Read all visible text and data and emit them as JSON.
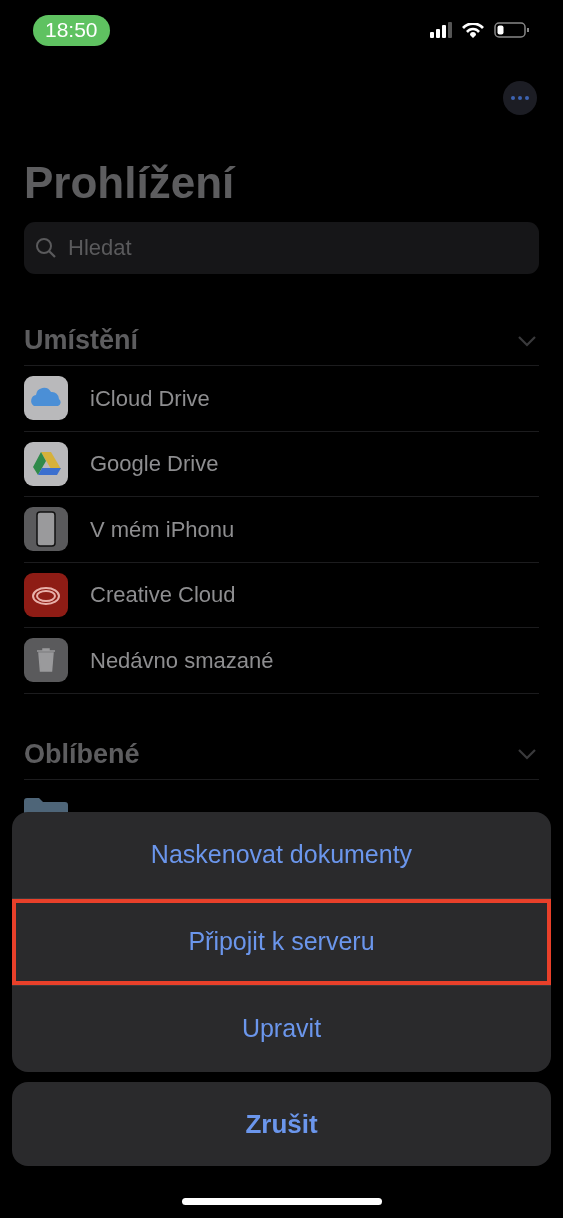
{
  "status_bar": {
    "time": "18:50"
  },
  "title": "Prohlížení",
  "search": {
    "placeholder": "Hledat"
  },
  "sections": [
    {
      "title": "Umístění",
      "expanded": true,
      "items": [
        {
          "kind": "icloud",
          "label": "iCloud Drive"
        },
        {
          "kind": "gdrive",
          "label": "Google Drive"
        },
        {
          "kind": "phone",
          "label": "V mém iPhonu"
        },
        {
          "kind": "creative",
          "label": "Creative Cloud"
        },
        {
          "kind": "trash",
          "label": "Nedávno smazané"
        }
      ]
    },
    {
      "title": "Oblíbené",
      "expanded": true,
      "items": [
        {
          "kind": "folder"
        }
      ]
    }
  ],
  "action_sheet": {
    "actions": [
      {
        "label": "Naskenovat dokumenty",
        "highlighted": false
      },
      {
        "label": "Připojit k serveru",
        "highlighted": true
      },
      {
        "label": "Upravit",
        "highlighted": false
      }
    ],
    "cancel": "Zrušit"
  }
}
